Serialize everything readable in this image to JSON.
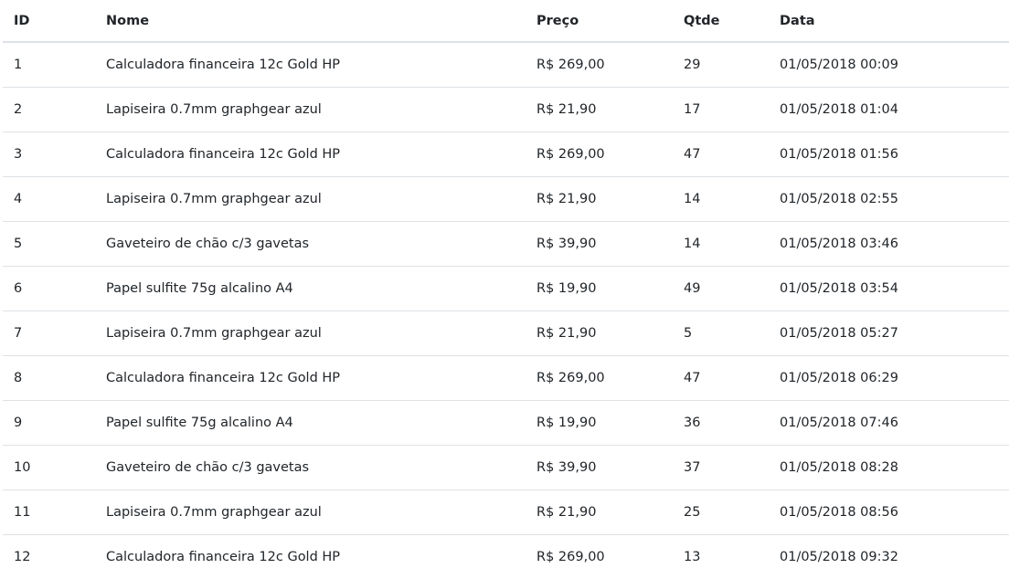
{
  "columns": [
    "ID",
    "Nome",
    "Preço",
    "Qtde",
    "Data"
  ],
  "rows": [
    [
      "1",
      "Calculadora financeira 12c Gold HP",
      "R$ 269,00",
      "29",
      "01/05/2018 00:09"
    ],
    [
      "2",
      "Lapiseira 0.7mm graphgear azul",
      "R$ 21,90",
      "17",
      "01/05/2018 01:04"
    ],
    [
      "3",
      "Calculadora financeira 12c Gold HP",
      "R$ 269,00",
      "47",
      "01/05/2018 01:56"
    ],
    [
      "4",
      "Lapiseira 0.7mm graphgear azul",
      "R$ 21,90",
      "14",
      "01/05/2018 02:55"
    ],
    [
      "5",
      "Gaveteiro de chão c/3 gavetas",
      "R$ 39,90",
      "14",
      "01/05/2018 03:46"
    ],
    [
      "6",
      "Papel sulfite 75g alcalino A4",
      "R$ 19,90",
      "49",
      "01/05/2018 03:54"
    ],
    [
      "7",
      "Lapiseira 0.7mm graphgear azul",
      "R$ 21,90",
      "5",
      "01/05/2018 05:27"
    ],
    [
      "8",
      "Calculadora financeira 12c Gold HP",
      "R$ 269,00",
      "47",
      "01/05/2018 06:29"
    ],
    [
      "9",
      "Papel sulfite 75g alcalino A4",
      "R$ 19,90",
      "36",
      "01/05/2018 07:46"
    ],
    [
      "10",
      "Gaveteiro de chão c/3 gavetas",
      "R$ 39,90",
      "37",
      "01/05/2018 08:28"
    ],
    [
      "11",
      "Lapiseira 0.7mm graphgear azul",
      "R$ 21,90",
      "25",
      "01/05/2018 08:56"
    ],
    [
      "12",
      "Calculadora financeira 12c Gold HP",
      "R$ 269,00",
      "13",
      "01/05/2018 09:32"
    ]
  ]
}
